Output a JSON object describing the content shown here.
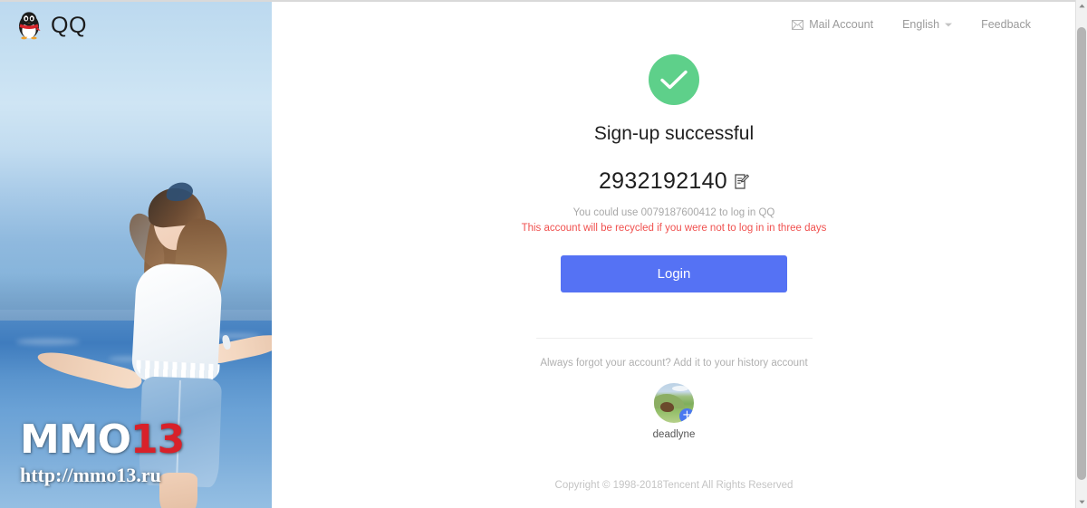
{
  "brand": {
    "name": "QQ",
    "logo_icon": "qq-penguin-icon"
  },
  "topbar": {
    "mail_account": "Mail Account",
    "mail_icon": "envelope-icon",
    "language": "English",
    "language_chevron_icon": "chevron-down-icon",
    "feedback": "Feedback"
  },
  "main": {
    "success_icon": "check-circle-icon",
    "title": "Sign-up successful",
    "account_number": "2932192140",
    "edit_icon": "edit-document-icon",
    "hint": "You could use 0079187600412 to log in QQ",
    "warning": "This account will be recycled if you were not to log in in three days",
    "login_label": "Login"
  },
  "history": {
    "hint": "Always forgot your account? Add it to your history account",
    "avatar_icon": "landscape-avatar",
    "add_badge": "+",
    "account_name": "deadlyne"
  },
  "footer": {
    "copyright": "Copyright © 1998-2018Tencent All Rights Reserved"
  },
  "watermark": {
    "brand_main": "MMO",
    "brand_accent": "13",
    "url": "http://mmo13.ru"
  },
  "colors": {
    "success_green": "#5ed08a",
    "login_blue": "#5572f4",
    "warning_red": "#f0514f",
    "badge_blue": "#4a78f0",
    "watermark_accent": "#d8212a"
  },
  "scrollbar": {
    "up_arrow_icon": "triangle-up-icon",
    "down_arrow_icon": "triangle-down-icon"
  }
}
